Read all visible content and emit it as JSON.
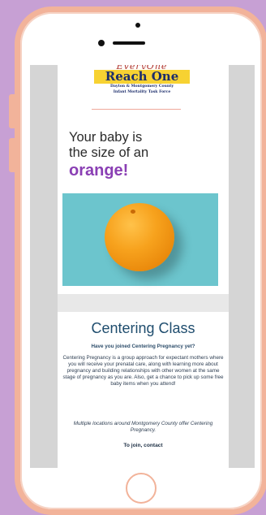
{
  "logo": {
    "everyone": "EveryOne",
    "reach_one": "Reach One",
    "tagline_line1": "Dayton & Montgomery County",
    "tagline_line2": "Infant Mortality Task Force"
  },
  "headline": {
    "line1": "Your baby is",
    "line2": "the size of an",
    "fruit": "orange!"
  },
  "photo": {
    "alt": "orange"
  },
  "centering": {
    "title": "Centering Class",
    "question": "Have you joined Centering Pregnancy yet?",
    "body": "Centering Pregnancy is a group approach for expectant mothers where you will receive your prenatal care, along with learning more about pregnancy and building relationships with other women at the same stage of pregnancy as you are. Also, get a chance to pick up some free baby items when you attend!",
    "locations": "Multiple locations around Montgomery County offer Centering Pregnancy.",
    "join": "To join, contact"
  },
  "colors": {
    "page_background": "#c7a0d4",
    "phone_frame": "#f2b39a",
    "fruit_text": "#8a3fb4",
    "title_text": "#1f4d6e",
    "photo_background": "#6cc5cd",
    "logo_band": "#f7d232"
  }
}
